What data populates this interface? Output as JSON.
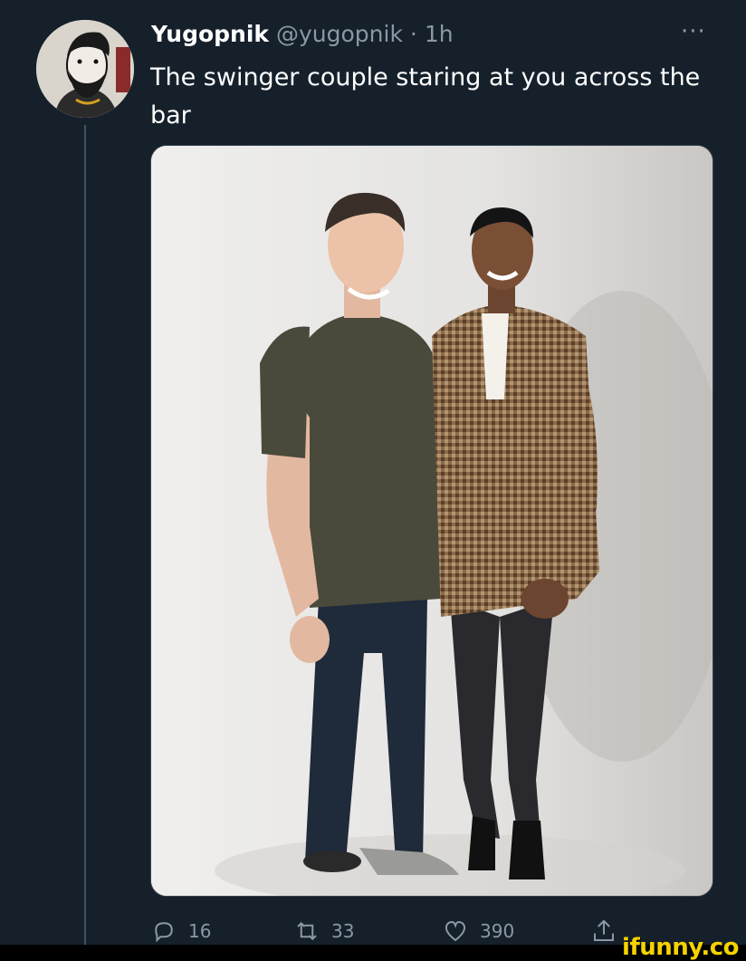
{
  "tweet": {
    "display_name": "Yugopnik",
    "handle": "@yugopnik",
    "separator": "·",
    "time": "1h",
    "more_label": "···",
    "text": "The swinger couple staring at you across the bar"
  },
  "actions": {
    "replies": "16",
    "retweets": "33",
    "likes": "390"
  },
  "icons": {
    "reply": "reply-icon",
    "retweet": "retweet-icon",
    "like": "heart-icon",
    "share": "share-icon"
  },
  "watermark": "ifunny.co",
  "colors": {
    "background": "#15202b",
    "secondary_text": "#8b98a5",
    "watermark": "#f5d300"
  }
}
